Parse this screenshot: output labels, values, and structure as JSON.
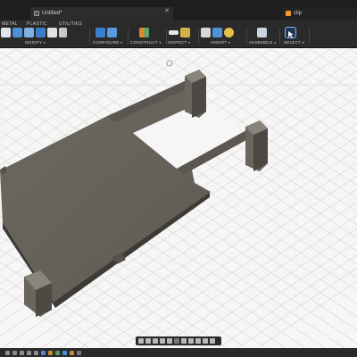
{
  "window": {
    "tabs": [
      {
        "label": "Untitled*",
        "icon": "lock-icon",
        "close": "✕"
      },
      {
        "label": "clip",
        "icon": "app-orange-icon"
      }
    ]
  },
  "toolbar": {
    "workspace_tabs": [
      "METAL",
      "PLASTIC",
      "UTILITIES"
    ],
    "groups": [
      {
        "label": "MODIFY",
        "icons": [
          "press-pull-icon",
          "fillet-icon",
          "shell-icon",
          "split-icon",
          "move-icon"
        ]
      },
      {
        "label": "CONFIGURE",
        "icons": [
          "configure-table-icon",
          "configure-rule-icon"
        ]
      },
      {
        "label": "CONSTRUCT",
        "icons": [
          "offset-plane-icon"
        ]
      },
      {
        "label": "INSPECT",
        "icons": [
          "measure-icon",
          "interference-icon"
        ]
      },
      {
        "label": "INSERT",
        "icons": [
          "insert-mesh-icon",
          "insert-image-icon",
          "decal-icon"
        ]
      },
      {
        "label": "ASSEMBLE",
        "icons": [
          "new-component-icon",
          "joint-icon"
        ]
      },
      {
        "label": "SELECT",
        "icons": [
          "select-arrow-icon"
        ]
      }
    ],
    "caret": "▾"
  },
  "viewport": {
    "model": "clip",
    "background": "#f6f6f6",
    "grid_color": "#d9d9d9",
    "body_color": "#67625a"
  },
  "navbar": {
    "icons": [
      "orbit-icon",
      "pan-icon",
      "look-at-icon",
      "zoom-icon",
      "fit-icon",
      "display-settings-icon",
      "grid-settings-icon",
      "viewports-icon"
    ]
  },
  "colors": {
    "accent": "#2f7fd6",
    "toolbar_bg": "#2a2a2a",
    "tab_bg": "#1e1e1e"
  }
}
